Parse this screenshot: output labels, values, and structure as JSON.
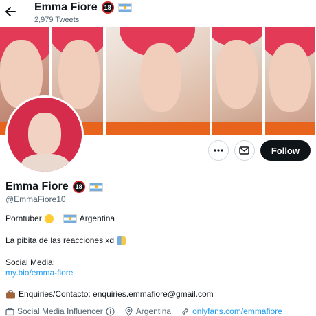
{
  "header": {
    "display_name": "Emma Fiore",
    "tweet_count": "2,979 Tweets"
  },
  "profile": {
    "name": "Emma Fiore",
    "handle": "@EmmaFiore10",
    "follow_label": "Follow",
    "bio": {
      "line1_a": "Porntuber",
      "line1_b": "Argentina",
      "line2": "La pibita de las reacciones xd",
      "line3": "Social Media:",
      "line4": "my.bio/emma-fiore",
      "line5": "Enquiries/Contacto: enquiries.emmafiore@gmail.com"
    },
    "meta": {
      "category": "Social Media Influencer",
      "location": "Argentina",
      "website": "onlyfans.com/emmafiore"
    }
  },
  "colors": {
    "accent": "#1d9bf0",
    "follow_bg": "#0f1419",
    "hair": "#e33a57"
  },
  "icons": [
    "back-arrow-icon",
    "age-18-badge-icon",
    "argentina-flag-icon",
    "more-icon",
    "mail-icon",
    "briefcase-icon",
    "info-icon",
    "location-pin-icon",
    "link-icon"
  ]
}
